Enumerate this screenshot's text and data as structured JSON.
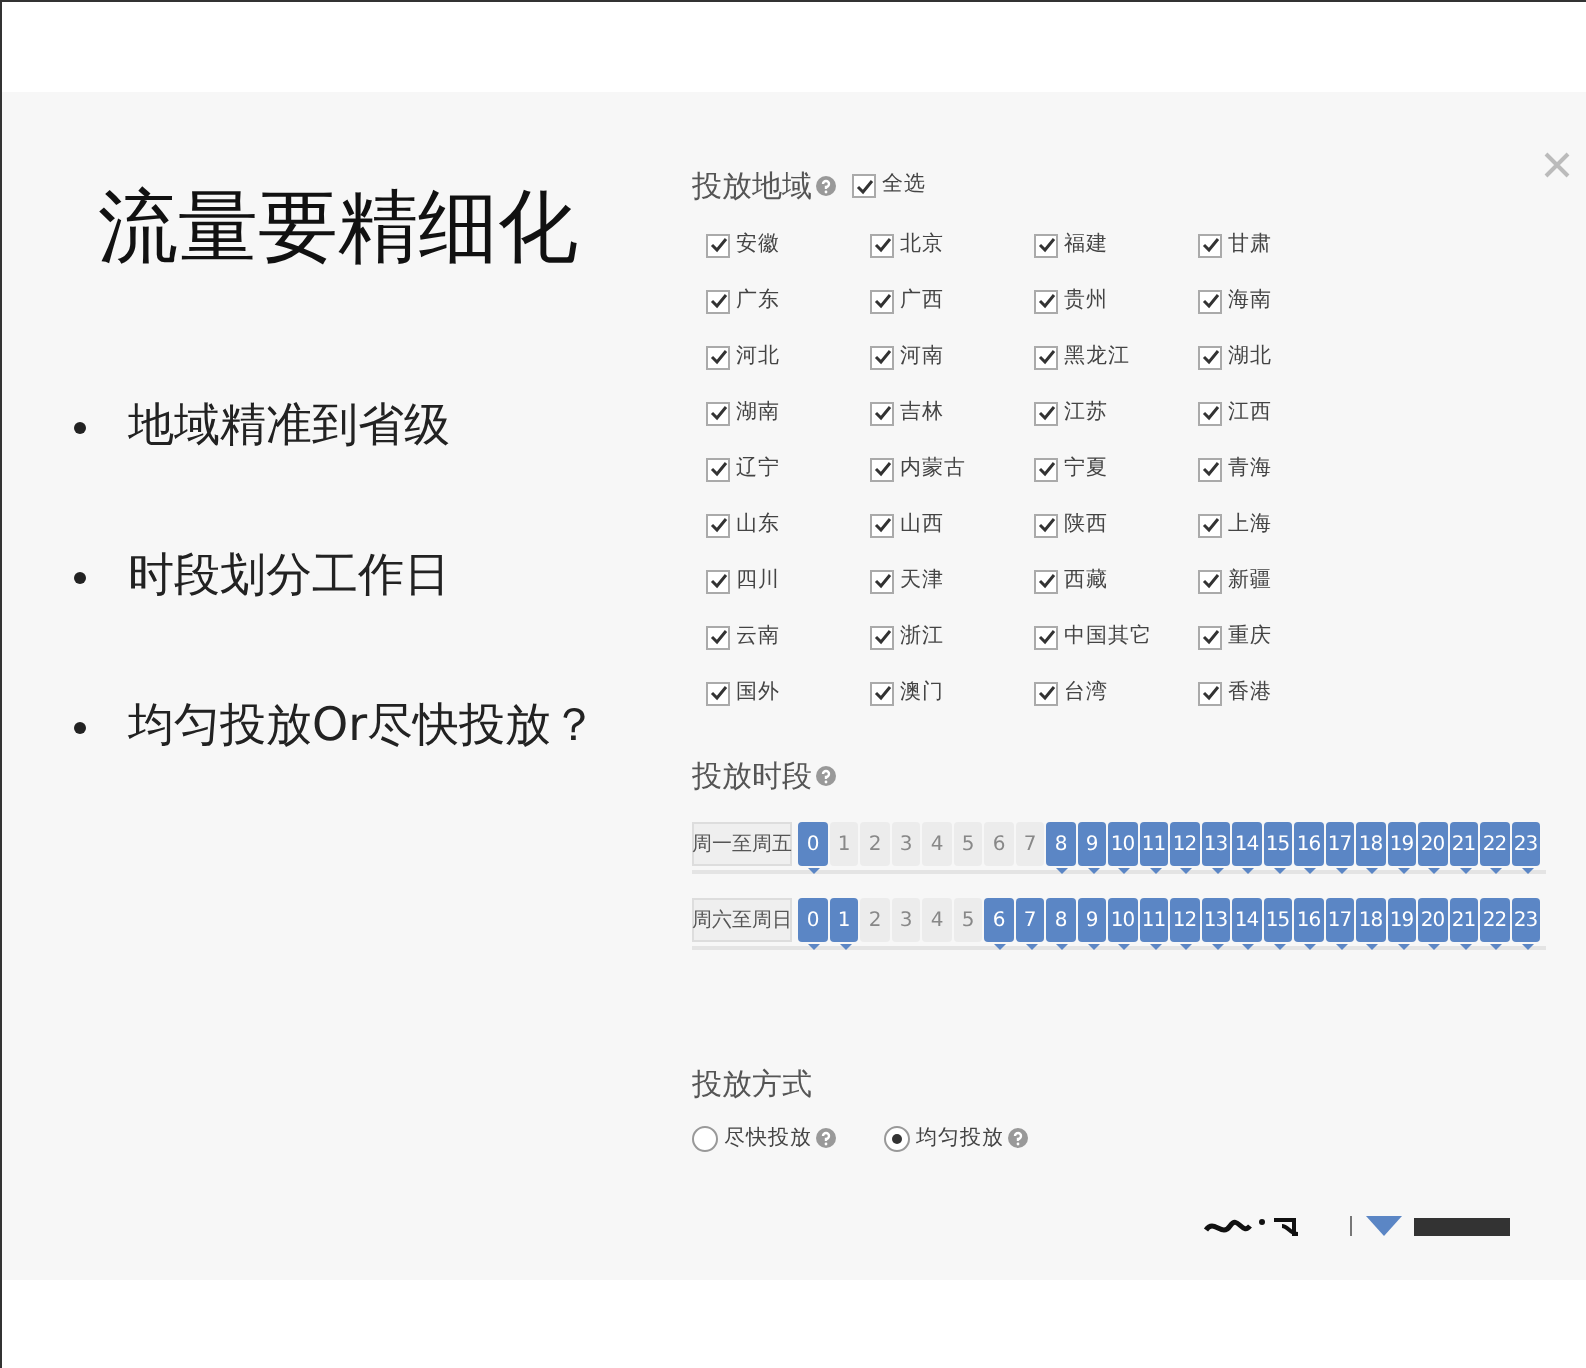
{
  "slide": {
    "title": "流量要精细化",
    "bullets": [
      "地域精准到省级",
      "时段划分工作日",
      "均匀投放Or尽快投放？"
    ]
  },
  "region": {
    "title": "投放地域",
    "select_all": {
      "label": "全选",
      "checked": true
    },
    "provinces": [
      {
        "label": "安徽",
        "checked": true
      },
      {
        "label": "北京",
        "checked": true
      },
      {
        "label": "福建",
        "checked": true
      },
      {
        "label": "甘肃",
        "checked": true
      },
      {
        "label": "广东",
        "checked": true
      },
      {
        "label": "广西",
        "checked": true
      },
      {
        "label": "贵州",
        "checked": true
      },
      {
        "label": "海南",
        "checked": true
      },
      {
        "label": "河北",
        "checked": true
      },
      {
        "label": "河南",
        "checked": true
      },
      {
        "label": "黑龙江",
        "checked": true
      },
      {
        "label": "湖北",
        "checked": true
      },
      {
        "label": "湖南",
        "checked": true
      },
      {
        "label": "吉林",
        "checked": true
      },
      {
        "label": "江苏",
        "checked": true
      },
      {
        "label": "江西",
        "checked": true
      },
      {
        "label": "辽宁",
        "checked": true
      },
      {
        "label": "内蒙古",
        "checked": true
      },
      {
        "label": "宁夏",
        "checked": true
      },
      {
        "label": "青海",
        "checked": true
      },
      {
        "label": "山东",
        "checked": true
      },
      {
        "label": "山西",
        "checked": true
      },
      {
        "label": "陕西",
        "checked": true
      },
      {
        "label": "上海",
        "checked": true
      },
      {
        "label": "四川",
        "checked": true
      },
      {
        "label": "天津",
        "checked": true
      },
      {
        "label": "西藏",
        "checked": true
      },
      {
        "label": "新疆",
        "checked": true
      },
      {
        "label": "云南",
        "checked": true
      },
      {
        "label": "浙江",
        "checked": true
      },
      {
        "label": "中国其它",
        "checked": true
      },
      {
        "label": "重庆",
        "checked": true
      },
      {
        "label": "国外",
        "checked": true
      },
      {
        "label": "澳门",
        "checked": true
      },
      {
        "label": "台湾",
        "checked": true
      },
      {
        "label": "香港",
        "checked": true
      }
    ]
  },
  "schedule": {
    "title": "投放时段",
    "rows": [
      {
        "label": "周一至周五",
        "hours": [
          {
            "label": "0",
            "selected": true
          },
          {
            "label": "1",
            "selected": false
          },
          {
            "label": "2",
            "selected": false
          },
          {
            "label": "3",
            "selected": false
          },
          {
            "label": "4",
            "selected": false
          },
          {
            "label": "5",
            "selected": false
          },
          {
            "label": "6",
            "selected": false
          },
          {
            "label": "7",
            "selected": false
          },
          {
            "label": "8",
            "selected": true
          },
          {
            "label": "9",
            "selected": true
          },
          {
            "label": "10",
            "selected": true
          },
          {
            "label": "11",
            "selected": true
          },
          {
            "label": "12",
            "selected": true
          },
          {
            "label": "13",
            "selected": true
          },
          {
            "label": "14",
            "selected": true
          },
          {
            "label": "15",
            "selected": true
          },
          {
            "label": "16",
            "selected": true
          },
          {
            "label": "17",
            "selected": true
          },
          {
            "label": "18",
            "selected": true
          },
          {
            "label": "19",
            "selected": true
          },
          {
            "label": "20",
            "selected": true
          },
          {
            "label": "21",
            "selected": true
          },
          {
            "label": "22",
            "selected": true
          },
          {
            "label": "23",
            "selected": true
          }
        ]
      },
      {
        "label": "周六至周日",
        "hours": [
          {
            "label": "0",
            "selected": true
          },
          {
            "label": "1",
            "selected": true
          },
          {
            "label": "2",
            "selected": false
          },
          {
            "label": "3",
            "selected": false
          },
          {
            "label": "4",
            "selected": false
          },
          {
            "label": "5",
            "selected": false
          },
          {
            "label": "6",
            "selected": true
          },
          {
            "label": "7",
            "selected": true
          },
          {
            "label": "8",
            "selected": true
          },
          {
            "label": "9",
            "selected": true
          },
          {
            "label": "10",
            "selected": true
          },
          {
            "label": "11",
            "selected": true
          },
          {
            "label": "12",
            "selected": true
          },
          {
            "label": "13",
            "selected": true
          },
          {
            "label": "14",
            "selected": true
          },
          {
            "label": "15",
            "selected": true
          },
          {
            "label": "16",
            "selected": true
          },
          {
            "label": "17",
            "selected": true
          },
          {
            "label": "18",
            "selected": true
          },
          {
            "label": "19",
            "selected": true
          },
          {
            "label": "20",
            "selected": true
          },
          {
            "label": "21",
            "selected": true
          },
          {
            "label": "22",
            "selected": true
          },
          {
            "label": "23",
            "selected": true
          }
        ]
      }
    ]
  },
  "delivery": {
    "title": "投放方式",
    "options": [
      {
        "label": "尽快投放",
        "selected": false
      },
      {
        "label": "均匀投放",
        "selected": true
      }
    ]
  }
}
